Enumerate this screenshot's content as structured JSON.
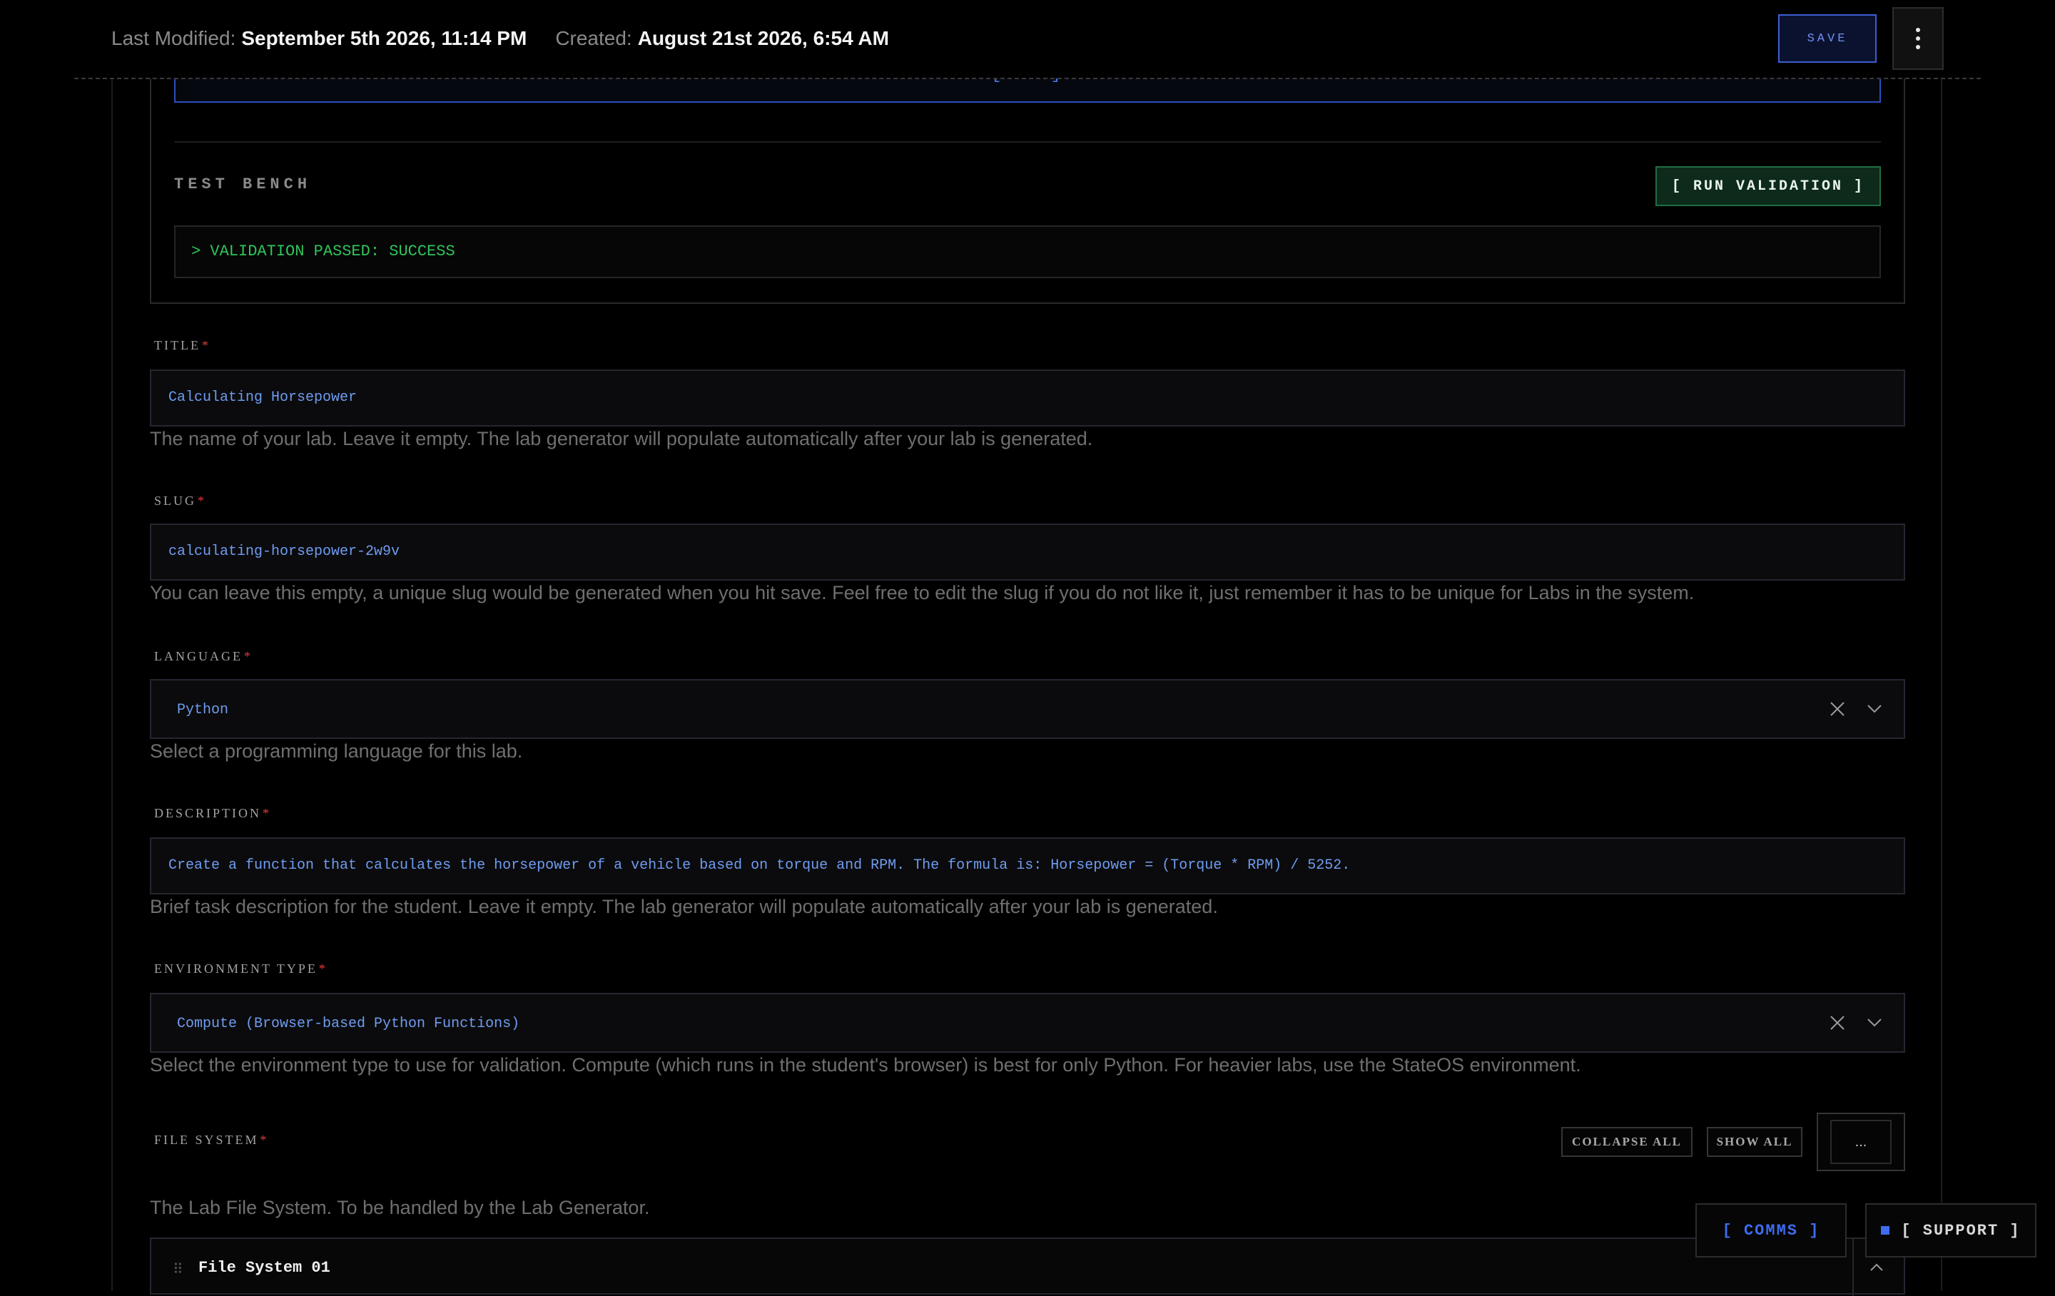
{
  "header": {
    "last_modified_label": "Last Modified:",
    "last_modified_value": "September 5th 2026, 11:14 PM",
    "created_label": "Created:",
    "created_value": "August 21st 2026, 6:54 AM",
    "save_label": "SAVE",
    "menu_icon": "vertical-dots-icon"
  },
  "test_bench": {
    "title": "TEST BENCH",
    "run_label": "[ RUN VALIDATION ]",
    "output": "> VALIDATION PASSED: SUCCESS"
  },
  "fields": {
    "title": {
      "label": "TITLE",
      "required": "*",
      "value": "Calculating Horsepower",
      "help": "The name of your lab. Leave it empty. The lab generator will populate automatically after your lab is generated."
    },
    "slug": {
      "label": "SLUG",
      "required": "*",
      "value": "calculating-horsepower-2w9v",
      "help": "You can leave this empty, a unique slug would be generated when you hit save. Feel free to edit the slug if you do not like it, just remember it has to be unique for Labs in the system."
    },
    "language": {
      "label": "LANGUAGE",
      "required": "*",
      "value": "Python",
      "help": "Select a programming language for this lab."
    },
    "description": {
      "label": "DESCRIPTION",
      "required": "*",
      "value": "Create a function that calculates the horsepower of a vehicle based on torque and RPM. The formula is: Horsepower = (Torque * RPM) / 5252.",
      "help": "Brief task description for the student. Leave it empty. The lab generator will populate automatically after your lab is generated."
    },
    "environment_type": {
      "label": "ENVIRONMENT TYPE",
      "required": "*",
      "value": "Compute (Browser-based Python Functions)",
      "help": "Select the environment type to use for validation. Compute (which runs in the student's browser) is best for only Python. For heavier labs, use the StateOS environment."
    }
  },
  "file_system": {
    "label": "FILE SYSTEM",
    "required": "*",
    "collapse_all_label": "COLLAPSE ALL",
    "show_all_label": "SHOW ALL",
    "more_label": "...",
    "help": "The Lab File System. To be handled by the Lab Generator.",
    "items": [
      {
        "name": "File System 01"
      }
    ]
  },
  "floating": {
    "comms_label": "[ COMMS ]",
    "support_label": "[ SUPPORT ]"
  },
  "colors": {
    "background": "#000000",
    "accent_blue": "#3d6cf0",
    "success_green": "#2fc55a",
    "required_red": "#e03a3a"
  }
}
